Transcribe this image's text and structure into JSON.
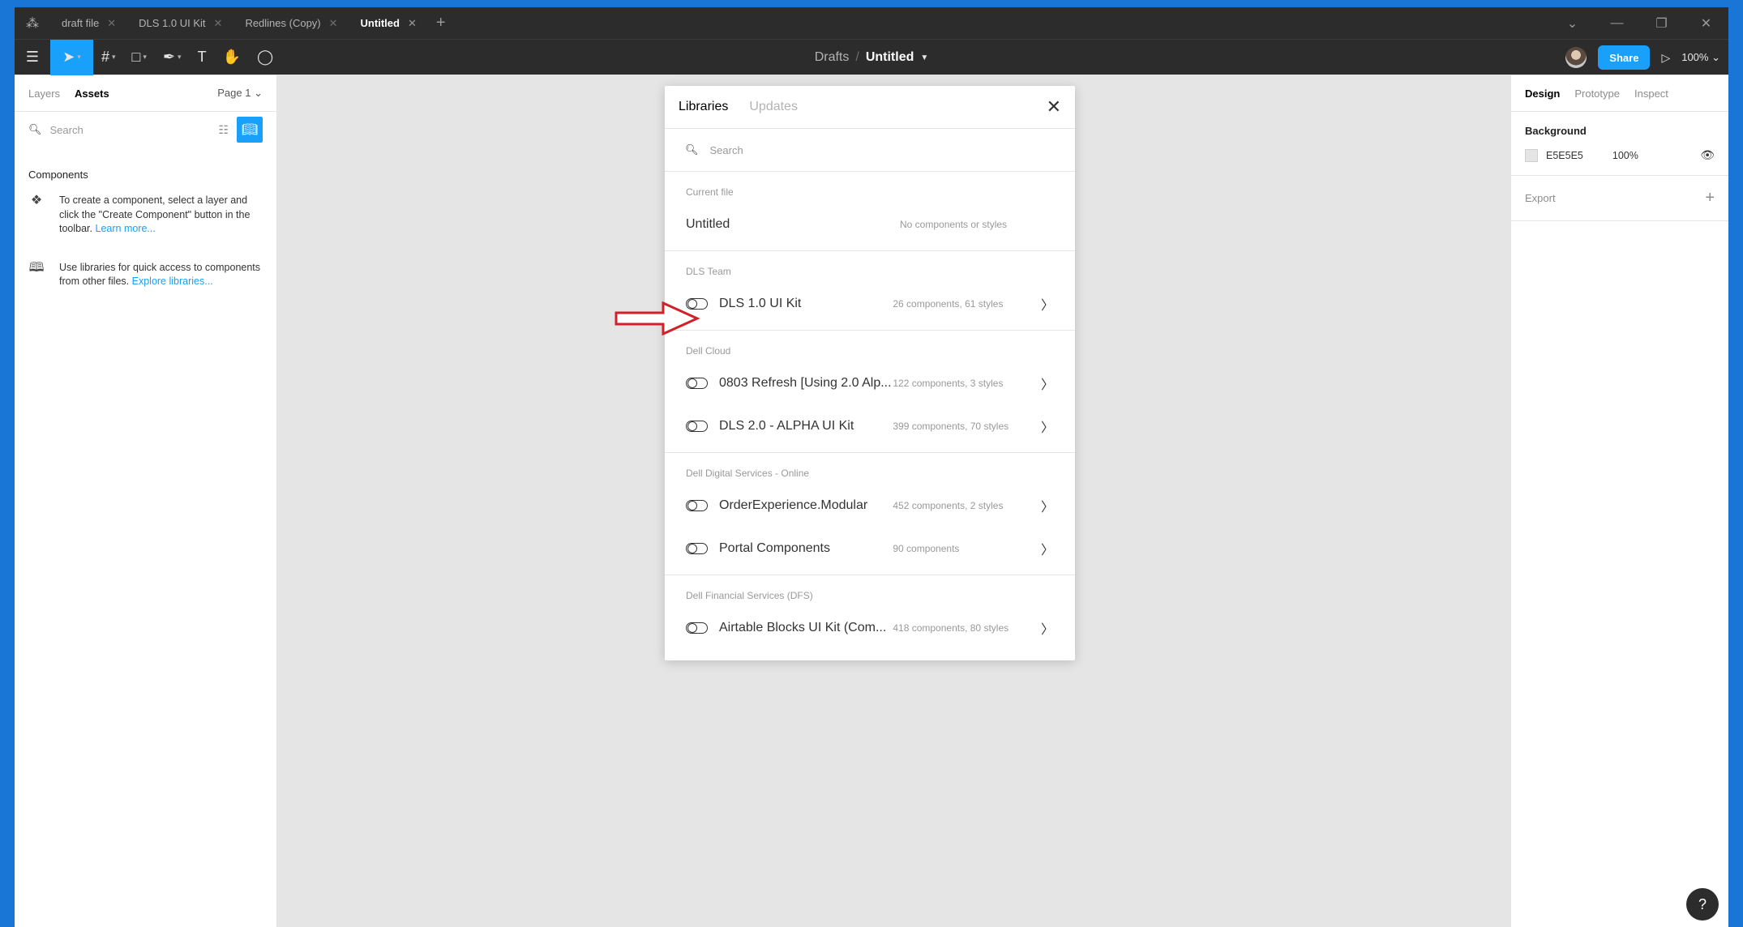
{
  "tabs": [
    {
      "label": "draft file",
      "active": false
    },
    {
      "label": "DLS 1.0 UI Kit",
      "active": false
    },
    {
      "label": "Redlines (Copy)",
      "active": false
    },
    {
      "label": "Untitled",
      "active": true
    }
  ],
  "toolbar": {
    "crumb_parent": "Drafts",
    "crumb_sep": "/",
    "crumb_current": "Untitled",
    "share_label": "Share",
    "zoom": "100%"
  },
  "left_panel": {
    "tab_layers": "Layers",
    "tab_assets": "Assets",
    "page": "Page 1",
    "search_placeholder": "Search",
    "components_title": "Components",
    "info1_text": "To create a component, select a layer and click the \"Create Component\" button in the toolbar.",
    "info1_link": "Learn more...",
    "info2_text": "Use libraries for quick access to components from other files.",
    "info2_link": "Explore libraries..."
  },
  "right_panel": {
    "tab_design": "Design",
    "tab_prototype": "Prototype",
    "tab_inspect": "Inspect",
    "background_title": "Background",
    "bg_hex": "E5E5E5",
    "bg_opacity": "100%",
    "export_title": "Export"
  },
  "modal": {
    "tab_libraries": "Libraries",
    "tab_updates": "Updates",
    "search_placeholder": "Search",
    "sections": [
      {
        "title": "Current file",
        "rows": [
          {
            "name": "Untitled",
            "meta": "No components or styles",
            "toggle": false,
            "arrow": false
          }
        ]
      },
      {
        "title": "DLS Team",
        "rows": [
          {
            "name": "DLS 1.0 UI Kit",
            "meta": "26 components, 61 styles",
            "toggle": true,
            "arrow": true
          }
        ]
      },
      {
        "title": "Dell Cloud",
        "rows": [
          {
            "name": "0803 Refresh [Using 2.0 Alp...",
            "meta": "122 components, 3 styles",
            "toggle": true,
            "arrow": true
          },
          {
            "name": "DLS 2.0 - ALPHA UI Kit",
            "meta": "399 components, 70 styles",
            "toggle": true,
            "arrow": true
          }
        ]
      },
      {
        "title": "Dell Digital Services - Online",
        "rows": [
          {
            "name": "OrderExperience.Modular",
            "meta": "452 components, 2 styles",
            "toggle": true,
            "arrow": true
          },
          {
            "name": "Portal Components",
            "meta": "90 components",
            "toggle": true,
            "arrow": true
          }
        ]
      },
      {
        "title": "Dell Financial Services (DFS)",
        "rows": [
          {
            "name": "Airtable Blocks UI Kit (Com...",
            "meta": "418 components, 80 styles",
            "toggle": true,
            "arrow": true
          }
        ]
      }
    ]
  },
  "colors": {
    "accent": "#18a0fb",
    "dark": "#2c2c2c",
    "canvas": "#e5e5e5",
    "annotation": "#d0202a"
  },
  "help_label": "?"
}
